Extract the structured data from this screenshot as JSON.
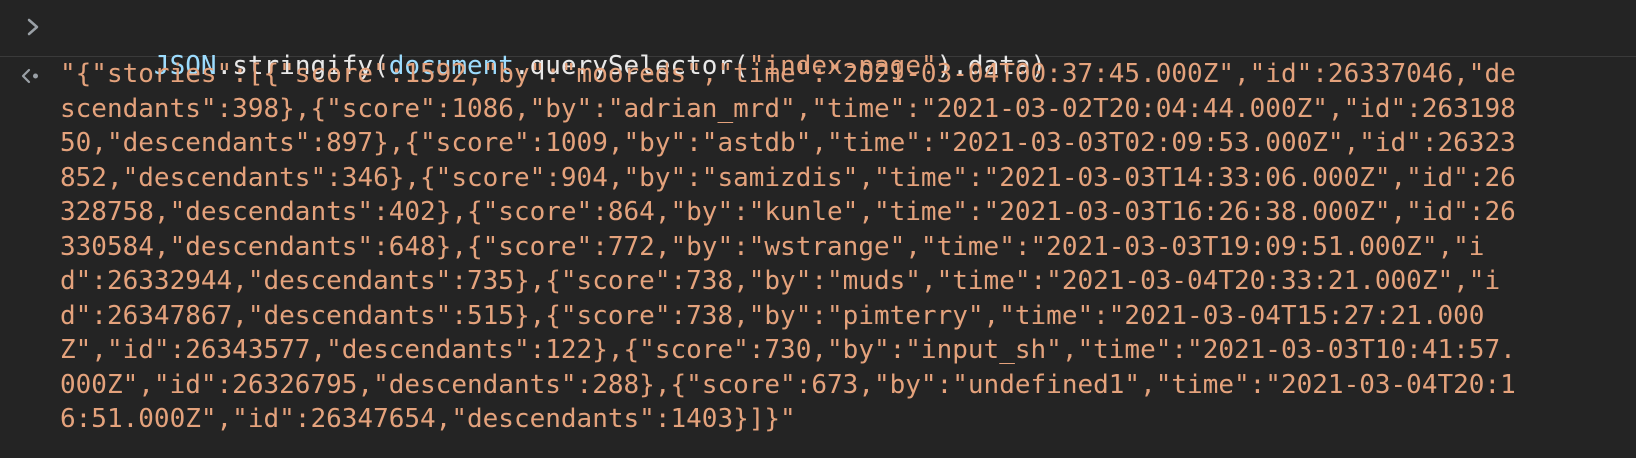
{
  "console": {
    "input": {
      "prompt_icon": "chevron-right-icon",
      "tokens": [
        {
          "text": "JSON",
          "kind": "global"
        },
        {
          "text": ".stringify(",
          "kind": "plain"
        },
        {
          "text": "document",
          "kind": "global"
        },
        {
          "text": ".querySelector(",
          "kind": "plain"
        },
        {
          "text": "\"index-page\"",
          "kind": "string"
        },
        {
          "text": ").data)",
          "kind": "plain"
        }
      ]
    },
    "output": {
      "return_icon": "return-arrow-icon",
      "value": "\"{\"stories\":[{\"score\":1592,\"by\":\"mooreds\",\"time\":\"2021-03-04T00:37:45.000Z\",\"id\":26337046,\"descendants\":398},{\"score\":1086,\"by\":\"adrian_mrd\",\"time\":\"2021-03-02T20:04:44.000Z\",\"id\":26319850,\"descendants\":897},{\"score\":1009,\"by\":\"astdb\",\"time\":\"2021-03-03T02:09:53.000Z\",\"id\":26323852,\"descendants\":346},{\"score\":904,\"by\":\"samizdis\",\"time\":\"2021-03-03T14:33:06.000Z\",\"id\":26328758,\"descendants\":402},{\"score\":864,\"by\":\"kunle\",\"time\":\"2021-03-03T16:26:38.000Z\",\"id\":26330584,\"descendants\":648},{\"score\":772,\"by\":\"wstrange\",\"time\":\"2021-03-03T19:09:51.000Z\",\"id\":26332944,\"descendants\":735},{\"score\":738,\"by\":\"muds\",\"time\":\"2021-03-04T20:33:21.000Z\",\"id\":26347867,\"descendants\":515},{\"score\":738,\"by\":\"pimterry\",\"time\":\"2021-03-04T15:27:21.000Z\",\"id\":26343577,\"descendants\":122},{\"score\":730,\"by\":\"input_sh\",\"time\":\"2021-03-03T10:41:57.000Z\",\"id\":26326795,\"descendants\":288},{\"score\":673,\"by\":\"undefined1\",\"time\":\"2021-03-04T20:16:51.000Z\",\"id\":26347654,\"descendants\":1403}]}\""
    }
  },
  "colors": {
    "background": "#242424",
    "divider": "#3a3a3a",
    "global_identifier": "#9cdcfe",
    "plain_code": "#e8e8e8",
    "string": "#e4a27c",
    "icon": "#9aa0a6"
  }
}
